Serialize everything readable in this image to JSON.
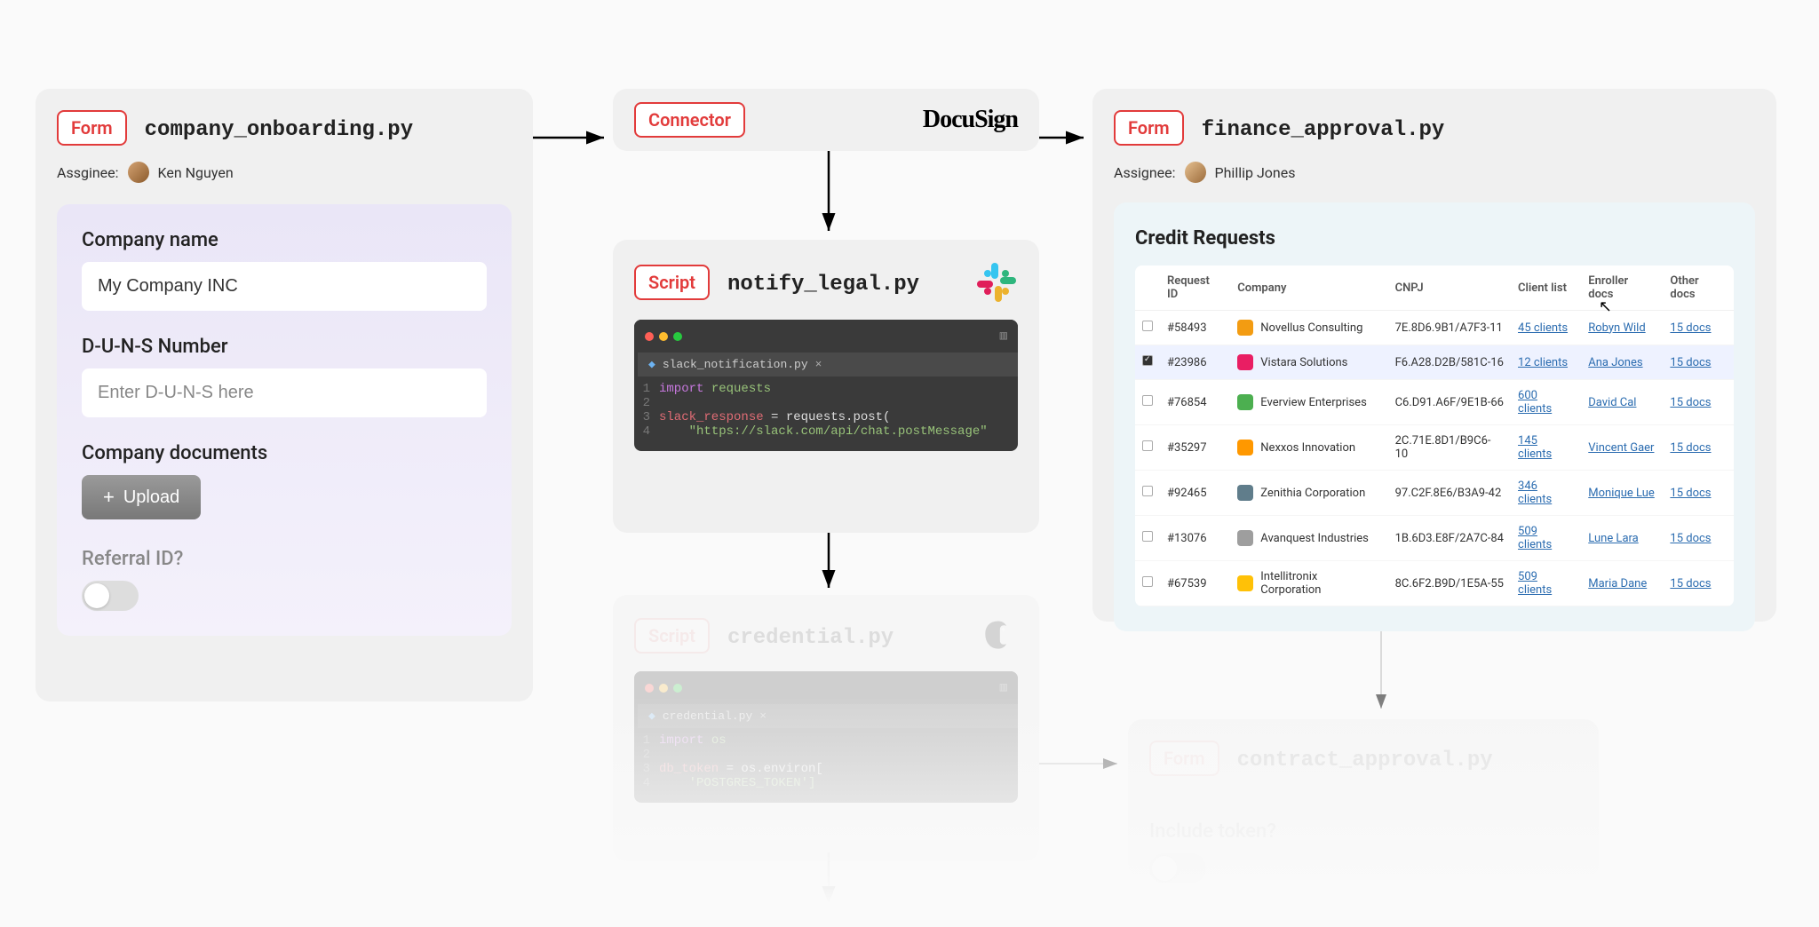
{
  "form_left": {
    "tag": "Form",
    "filename": "company_onboarding.py",
    "assignee_label": "Assginee:",
    "assignee_name": "Ken Nguyen",
    "company_label": "Company name",
    "company_value": "My Company INC",
    "duns_label": "D-U-N-S Number",
    "duns_placeholder": "Enter D-U-N-S here",
    "docs_label": "Company documents",
    "upload_label": "Upload",
    "referral_label": "Referral ID?"
  },
  "connector": {
    "tag": "Connector",
    "brand": "DocuSign"
  },
  "script1": {
    "tag": "Script",
    "filename": "notify_legal.py",
    "tab_name": "slack_notification.py",
    "code_lines": [
      {
        "n": "1",
        "html": "import_requests"
      },
      {
        "n": "2",
        "html": "blank"
      },
      {
        "n": "3",
        "html": "assign"
      },
      {
        "n": "4",
        "html": "url"
      }
    ],
    "l1_import": "import",
    "l1_module": "requests",
    "l3_var": "slack_response",
    "l3_rest": " = requests.post(",
    "l4_indent": "    ",
    "l4_url": "\"https://slack.com/api/chat.postMessage\""
  },
  "script2": {
    "tag": "Script",
    "filename": "credential.py",
    "tab_name": "credential.py",
    "l1_import": "import",
    "l1_module": "os",
    "l3_var": "db_token",
    "l3_rest": " = os.environ[",
    "l4_text": "'POSTGRES_TOKEN']"
  },
  "finance": {
    "tag": "Form",
    "filename": "finance_approval.py",
    "assignee_label": "Assignee:",
    "assignee_name": "Phillip Jones",
    "panel_title": "Credit Requests",
    "columns": [
      "",
      "Request ID",
      "Company",
      "CNPJ",
      "Client list",
      "Enroller docs",
      "Other docs"
    ],
    "rows": [
      {
        "checked": false,
        "id": "#58493",
        "icon_color": "#f39c12",
        "company": "Novellus Consulting",
        "cnpj": "7E.8D6.9B1/A7F3-11",
        "clients": "45 clients",
        "enroller": "Robyn Wild",
        "other": "15 docs"
      },
      {
        "checked": true,
        "id": "#23986",
        "icon_color": "#e91e63",
        "company": "Vistara Solutions",
        "cnpj": "F6.A28.D2B/581C-16",
        "clients": "12 clients",
        "enroller": "Ana Jones",
        "other": "15 docs"
      },
      {
        "checked": false,
        "id": "#76854",
        "icon_color": "#4caf50",
        "company": "Everview Enterprises",
        "cnpj": "C6.D91.A6F/9E1B-66",
        "clients": "600 clients",
        "enroller": "David Cal",
        "other": "15 docs"
      },
      {
        "checked": false,
        "id": "#35297",
        "icon_color": "#ff9800",
        "company": "Nexxos Innovation",
        "cnpj": "2C.71E.8D1/B9C6-10",
        "clients": "145 clients",
        "enroller": "Vincent Gaer",
        "other": "15 docs"
      },
      {
        "checked": false,
        "id": "#92465",
        "icon_color": "#607d8b",
        "company": "Zenithia Corporation",
        "cnpj": "97.C2F.8E6/B3A9-42",
        "clients": "346 clients",
        "enroller": "Monique Lue",
        "other": "15 docs"
      },
      {
        "checked": false,
        "id": "#13076",
        "icon_color": "#9e9e9e",
        "company": "Avanquest Industries",
        "cnpj": "1B.6D3.E8F/2A7C-84",
        "clients": "509 clients",
        "enroller": "Lune Lara",
        "other": "15 docs"
      },
      {
        "checked": false,
        "id": "#67539",
        "icon_color": "#ffc107",
        "company": "Intellitronix Corporation",
        "cnpj": "8C.6F2.B9D/1E5A-55",
        "clients": "509 clients",
        "enroller": "Maria Dane",
        "other": "15 docs"
      }
    ]
  },
  "contract": {
    "tag": "Form",
    "filename": "contract_approval.py",
    "toggle_label": "Include token?"
  }
}
